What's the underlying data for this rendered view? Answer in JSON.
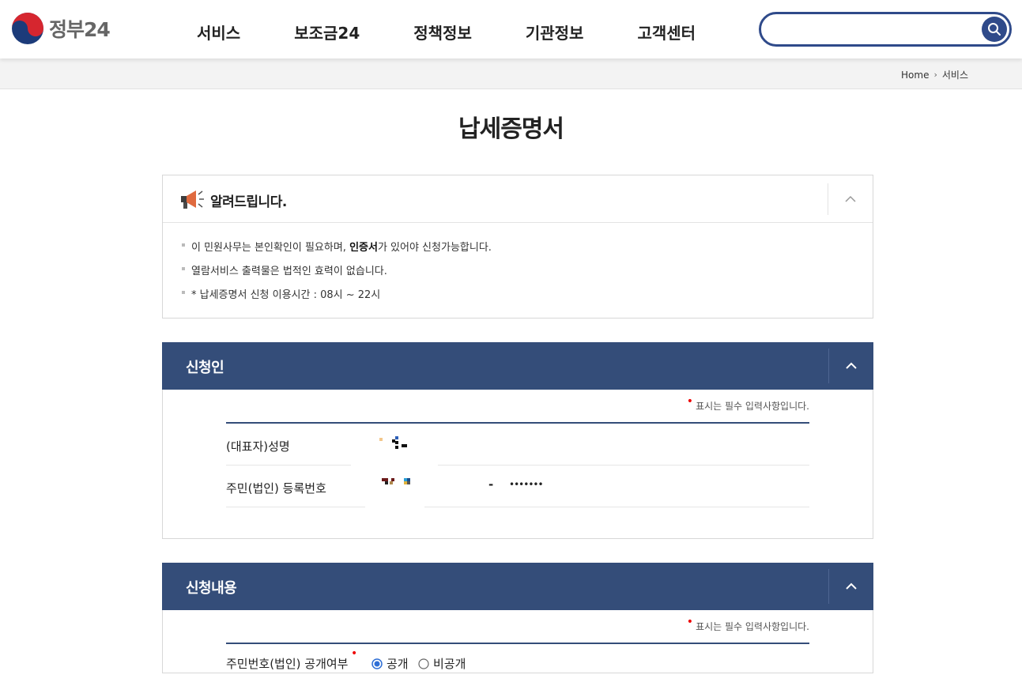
{
  "header": {
    "logo_text": "정부24",
    "nav": [
      "서비스",
      "보조금24",
      "정책정보",
      "기관정보",
      "고객센터"
    ],
    "search": {
      "placeholder": "",
      "value": ""
    }
  },
  "breadcrumb": {
    "home": "Home",
    "current": "서비스"
  },
  "page_title": "납세증명서",
  "notice": {
    "title": "알려드립니다.",
    "items": [
      {
        "before": "이 민원사무는 본인확인이 필요하며, ",
        "bold": "인증서",
        "after": "가 있어야 신청가능합니다."
      },
      {
        "before": "열람서비스 출력물은 법적인 효력이 없습니다.",
        "bold": "",
        "after": ""
      },
      {
        "before": "* 납세증명서 신청 이용시간 : 08시 ~ 22시",
        "bold": "",
        "after": ""
      }
    ]
  },
  "applicant": {
    "title": "신청인",
    "required_note": "표시는 필수 입력사항입니다.",
    "fields": [
      {
        "label": "(대표자)성명",
        "value": ""
      },
      {
        "label": "주민(법인) 등록번호",
        "value_sep": "-",
        "value_masked": "•••••••"
      }
    ]
  },
  "application": {
    "title": "신청내용",
    "required_note": "표시는 필수 입력사항입니다.",
    "fields": [
      {
        "label": "주민번호(법인) 공개여부",
        "options": [
          "공개",
          "비공개"
        ],
        "selected": "공개"
      }
    ]
  },
  "colors": {
    "primary": "#344d79",
    "search_border": "#2f4a8a",
    "required_dot": "#e00000"
  }
}
